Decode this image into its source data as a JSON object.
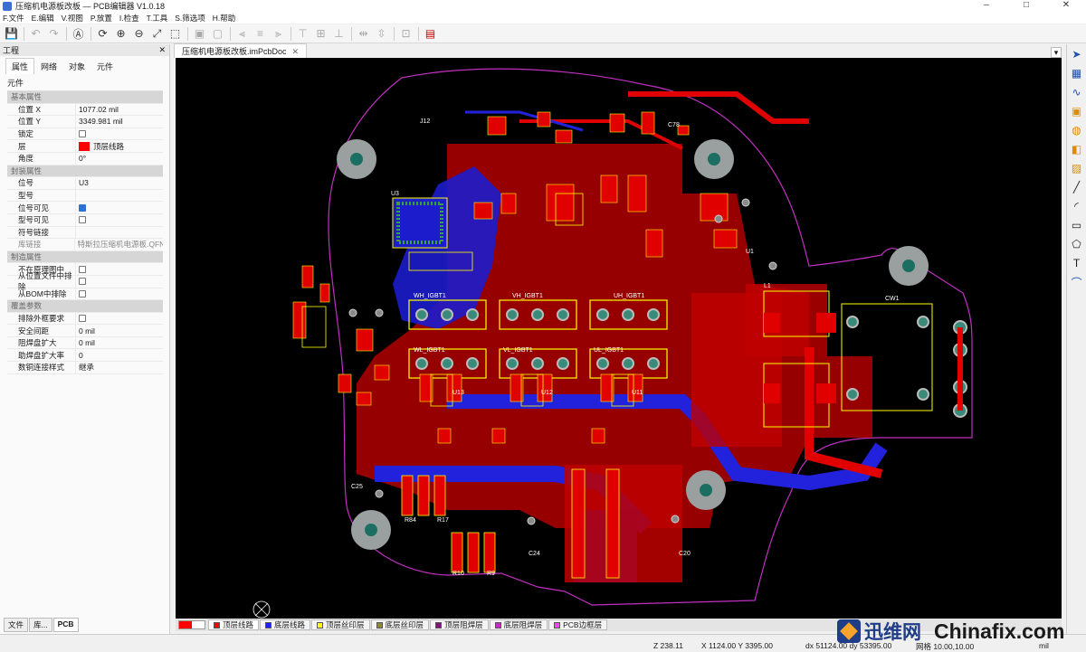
{
  "window": {
    "title": "压缩机电源板改板 — PCB编辑器  V1.0.18",
    "minimize": "–",
    "maximize": "□",
    "close": "✕"
  },
  "menu": [
    "F.文件",
    "E.编辑",
    "V.视图",
    "P.放置",
    "I.检查",
    "T.工具",
    "S.筛选项",
    "H.帮助"
  ],
  "left_panel": {
    "title": "工程",
    "close": "✕",
    "tabs": [
      "属性",
      "网络",
      "对象",
      "元件"
    ],
    "active_tab": "属性",
    "subtitle": "元件",
    "sections": {
      "basic": {
        "title": "基本属性",
        "pos_x_label": "位置 X",
        "pos_x": "1077.02 mil",
        "pos_y_label": "位置 Y",
        "pos_y": "3349.981 mil",
        "lock_label": "锁定",
        "layer_label": "层",
        "layer": "顶层线路",
        "angle_label": "角度",
        "angle": "0°"
      },
      "package": {
        "title": "封装属性",
        "ref_label": "位号",
        "ref": "U3",
        "model_label": "型号",
        "model": "",
        "ref_visible_label": "位号可见",
        "model_visible_label": "型号可见",
        "symbol_link_label": "符号链接",
        "symbol_link": "",
        "lib_link_label": "库链接",
        "lib_link": "特斯拉压缩机电源板.QFN"
      },
      "manufacture": {
        "title": "制造属性",
        "not_in_schematic": "不在原理图中",
        "exclude_pos": "从位置文件中排除",
        "exclude_bom": "从BOM中排除"
      },
      "override": {
        "title": "覆盖参数",
        "exclude_courtyard": "排除外框要求",
        "clearance_label": "安全间距",
        "clearance": "0 mil",
        "mask_label": "阻焊盘扩大",
        "mask": "0 mil",
        "paste_label": "助焊盘扩大率",
        "paste": "0",
        "zone_label": "数铜连接样式",
        "zone": "继承"
      }
    },
    "bottom_tabs": [
      "文件",
      "库...",
      "PCB"
    ]
  },
  "doc_tab": {
    "label": "压缩机电源板改板.imPcbDoc",
    "close": "✕"
  },
  "layers": [
    {
      "label": "顶层线路",
      "color": "#ff0000"
    },
    {
      "label": "底层线路",
      "color": "#2020ff"
    },
    {
      "label": "顶层丝印层",
      "color": "#ffff00"
    },
    {
      "label": "底层丝印层",
      "color": "#8c8c2a"
    },
    {
      "label": "顶层阻焊层",
      "color": "#7a1a7a"
    },
    {
      "label": "底层阻焊层",
      "color": "#c030c0"
    },
    {
      "label": "PCB边框层",
      "color": "#ff40ff"
    }
  ],
  "status": {
    "zoom": "Z 238.11",
    "xy": "X 1124.00  Y 3395.00",
    "dxy": "dx 51124.00  dy 53395.00",
    "grid": "网格 10.00,10.00",
    "unit": "mil"
  },
  "watermark": {
    "cn": "迅维网",
    "en": "Chinafix.com"
  },
  "pcb": {
    "labels": [
      "UH_IGBT1",
      "VH_IGBT1",
      "WH_IGBT1",
      "UL_IGBT1",
      "VL_IGBT1",
      "WL_IGBT1",
      "U3",
      "U1",
      "U11",
      "U12",
      "U13",
      "CW1",
      "R84",
      "R17",
      "R10",
      "R9",
      "C20",
      "C24",
      "C25",
      "J12",
      "L1",
      "C78"
    ]
  }
}
